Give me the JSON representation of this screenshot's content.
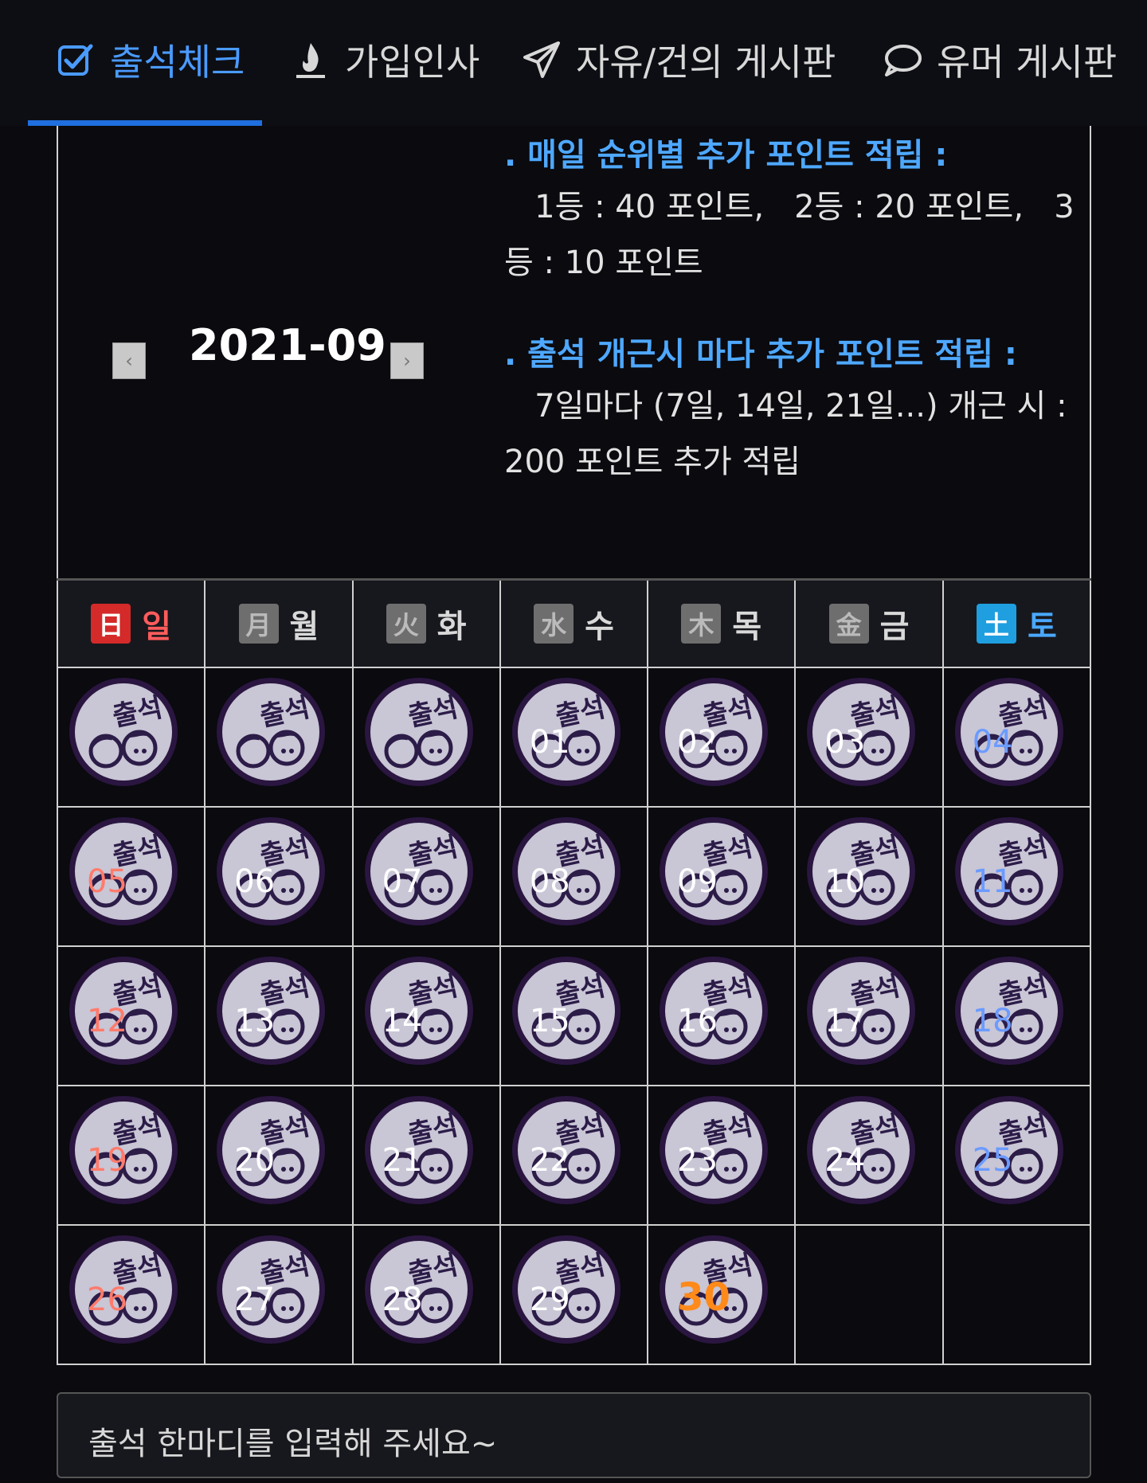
{
  "nav": {
    "tabs": [
      {
        "label": "출석체크",
        "icon": "checkbox-icon",
        "active": true
      },
      {
        "label": "가입인사",
        "icon": "flame-icon",
        "active": false
      },
      {
        "label": "자유/건의 게시판",
        "icon": "paper-plane-icon",
        "active": false
      },
      {
        "label": "유머 게시판",
        "icon": "speech-bubble-icon",
        "active": false
      }
    ],
    "accent_color": "#4a9bff"
  },
  "month": {
    "label": "2021-09",
    "prev_symbol": "‹",
    "next_symbol": "›"
  },
  "info": {
    "daily_heading": ". 매일 순위별 추가 포인트 적립 :",
    "daily_line1": "   1등 : 40 포인트,   2등 : 20 포인트,   3",
    "daily_line2": "등 : 10 포인트",
    "streak_heading": ". 출석 개근시 마다 추가 포인트 적립 :",
    "streak_line1": "   7일마다 (7일, 14일, 21일...) 개근 시 :",
    "streak_line2": "200 포인트 추가 적립"
  },
  "calendar": {
    "weekdays": [
      {
        "hanja": "日",
        "label": "일"
      },
      {
        "hanja": "月",
        "label": "월"
      },
      {
        "hanja": "火",
        "label": "화"
      },
      {
        "hanja": "水",
        "label": "수"
      },
      {
        "hanja": "木",
        "label": "목"
      },
      {
        "hanja": "金",
        "label": "금"
      },
      {
        "hanja": "土",
        "label": "토"
      }
    ],
    "stamp_text": "출석",
    "weeks": [
      [
        "",
        "",
        "",
        "01",
        "02",
        "03",
        "04"
      ],
      [
        "05",
        "06",
        "07",
        "08",
        "09",
        "10",
        "11"
      ],
      [
        "12",
        "13",
        "14",
        "15",
        "16",
        "17",
        "18"
      ],
      [
        "19",
        "20",
        "21",
        "22",
        "23",
        "24",
        "25"
      ],
      [
        "26",
        "27",
        "28",
        "29",
        "30",
        "-",
        "-"
      ]
    ],
    "today": "30"
  },
  "comment": {
    "placeholder": "출석 한마디를 입력해 주세요~"
  }
}
